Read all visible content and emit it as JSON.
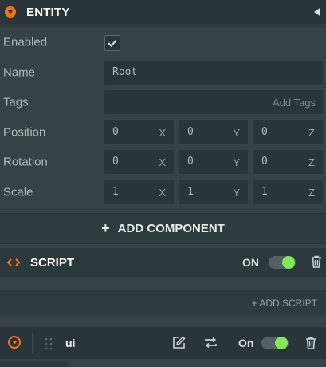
{
  "entity": {
    "title": "ENTITY",
    "enabled_label": "Enabled",
    "enabled": true,
    "name_label": "Name",
    "name_value": "Root",
    "tags_label": "Tags",
    "tags_placeholder": "Add Tags",
    "position_label": "Position",
    "position": [
      "0",
      "0",
      "0"
    ],
    "rotation_label": "Rotation",
    "rotation": [
      "0",
      "0",
      "0"
    ],
    "scale_label": "Scale",
    "scale": [
      "1",
      "1",
      "1"
    ],
    "axes": [
      "X",
      "Y",
      "Z"
    ]
  },
  "add_component": {
    "plus": "+",
    "label": "ADD COMPONENT"
  },
  "script": {
    "title": "SCRIPT",
    "state_label": "ON",
    "add_script_label": "+ ADD SCRIPT",
    "scripts": [
      {
        "name": "ui",
        "state_label": "On"
      }
    ]
  },
  "colors": {
    "accent": "#fb6f1d",
    "toggle_on": "#7fe85b",
    "panel": "#364346",
    "header": "#293538"
  }
}
